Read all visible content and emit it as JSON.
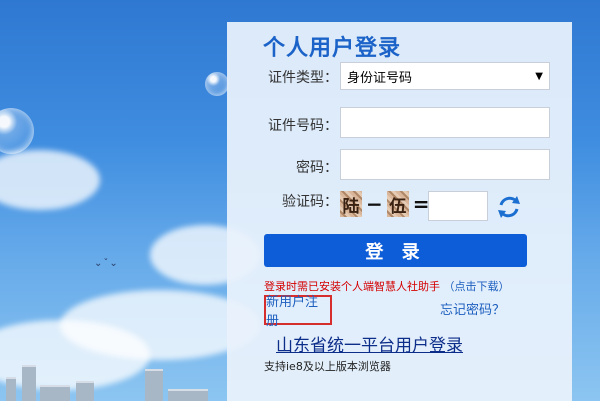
{
  "colors": {
    "accent": "#0d5dd8",
    "title": "#1b63c8",
    "warning": "#d40000",
    "link": "#1d5fbf",
    "highlight_border": "#d62d2d"
  },
  "login": {
    "title": "个人用户登录",
    "id_type_label": "证件类型：",
    "id_type_selected": "身份证号码",
    "id_number_label": "证件号码：",
    "id_number_value": "",
    "password_label": "密码：",
    "password_value": "",
    "captcha_label": "验证码：",
    "captcha_chars": [
      "陆",
      "−",
      "伍",
      "="
    ],
    "captcha_value": "",
    "submit_label": "登 录",
    "notice_text": "登录时需已安装个人端智慧人社助手",
    "download_link": "（点击下载）",
    "register_link": "新用户注册",
    "forgot_link": "忘记密码？",
    "unified_login_link": "山东省统一平台用户登录",
    "browser_support": "支持ie8及以上版本浏览器"
  },
  "icons": {
    "dropdown": "chevron-down-icon",
    "refresh": "refresh-icon"
  }
}
